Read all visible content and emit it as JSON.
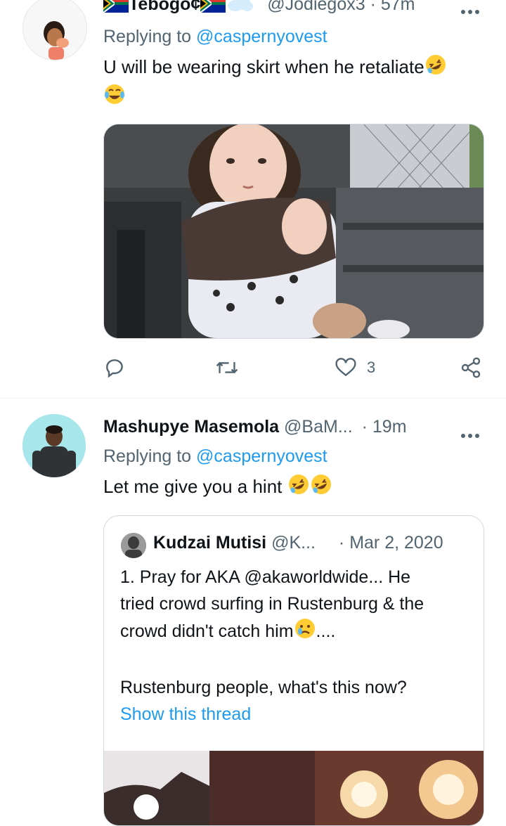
{
  "tweet1": {
    "display_name": "Tebogo¢",
    "handle": "@Jodiegox3",
    "separator": "·",
    "time": "57m",
    "replying_prefix": "Replying to",
    "replying_handle": "@caspernyovest",
    "text": "U will be wearing skirt when he retaliate",
    "actions": {
      "reply_count": "",
      "retweet_count": "",
      "like_count": "3"
    }
  },
  "tweet2": {
    "display_name": "Mashupye Masemola",
    "handle": "@BaM...",
    "separator": "·",
    "time": "19m",
    "replying_prefix": "Replying to",
    "replying_handle": "@caspernyovest",
    "text": "Let me give you a hint",
    "quote": {
      "display_name": "Kudzai Mutisi",
      "handle": "@K...",
      "separator": "·",
      "date": "Mar 2, 2020",
      "line1": "1. Pray for AKA @akaworldwide... He",
      "line2": "tried crowd surfing in Rustenburg & the",
      "line3_prefix": "crowd didn't catch him",
      "line3_suffix": "....",
      "line4": "Rustenburg people, what's this now?",
      "show_thread": "Show this thread"
    }
  },
  "icons": {
    "more": "more-horizontal-icon",
    "reply": "reply-icon",
    "retweet": "retweet-icon",
    "like": "heart-icon",
    "share": "share-icon",
    "flag": "south-africa-flag-icon",
    "cloud": "cloud-icon",
    "laugh": "rolling-laughing-emoji",
    "tears": "tears-of-joy-emoji",
    "cry": "crying-face-emoji"
  },
  "colors": {
    "accent": "#1d9bf0",
    "muted": "#536471",
    "text": "#0f1419",
    "border": "#cfd9de"
  }
}
